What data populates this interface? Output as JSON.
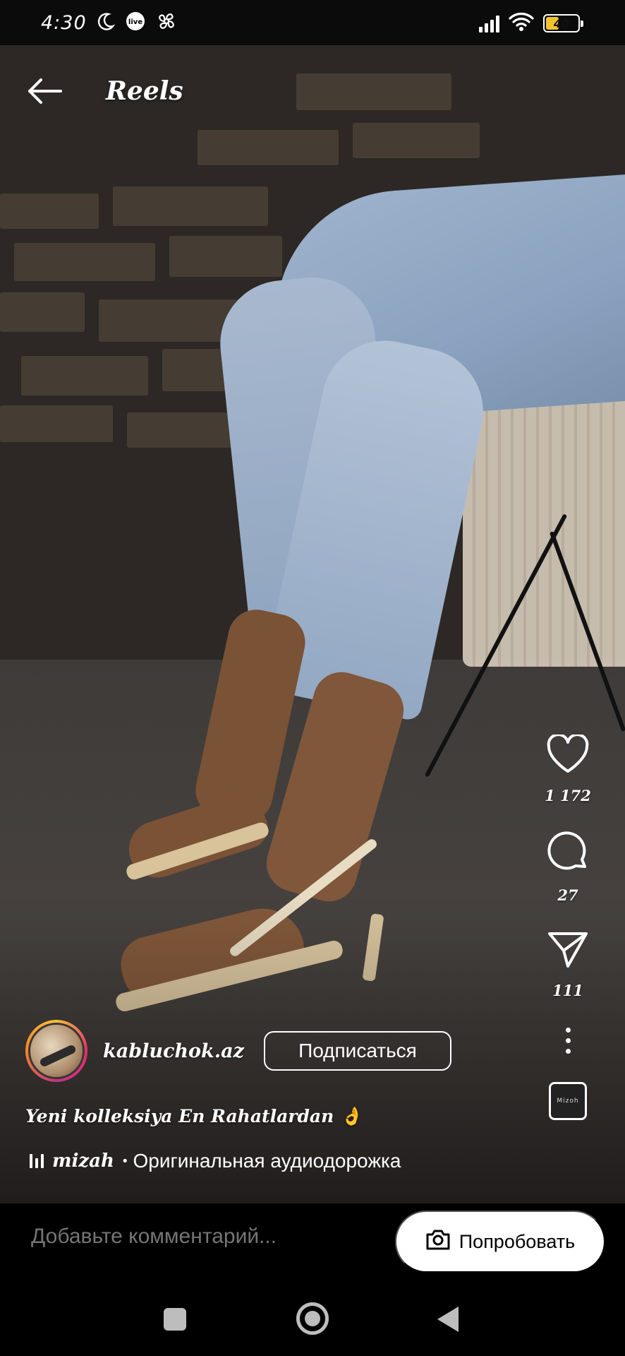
{
  "status_bar": {
    "time": "4:30",
    "icons": [
      "moon-icon",
      "live-icon",
      "fan-icon",
      "signal-icon",
      "wifi-icon",
      "battery-icon"
    ],
    "battery_level": "40",
    "battery_color": "#f2c230"
  },
  "top_bar": {
    "back_icon": "arrow-left-icon",
    "title": "Reels"
  },
  "actions": {
    "like_icon": "heart-icon",
    "like_count": "1 172",
    "comment_icon": "comment-bubble-icon",
    "comment_count": "27",
    "share_icon": "paper-plane-icon",
    "share_count": "111",
    "more_icon": "more-vertical-icon",
    "audio_thumb_label": "Mizoh"
  },
  "author": {
    "username": "kabluchok.az",
    "follow_label": "Подписаться"
  },
  "caption": "Yeni kolleksiya En Rahatlardan 👌",
  "audio": {
    "icon": "audio-bars-icon",
    "author": "mizah",
    "separator": "•",
    "track": "Оригинальная аудиодорожка"
  },
  "comment_bar": {
    "placeholder": "Добавьте комментарий...",
    "try_icon": "camera-icon",
    "try_label": "Попробовать"
  },
  "nav": {
    "recent_icon": "square-icon",
    "home_icon": "circle-icon",
    "back_icon": "triangle-back-icon"
  }
}
